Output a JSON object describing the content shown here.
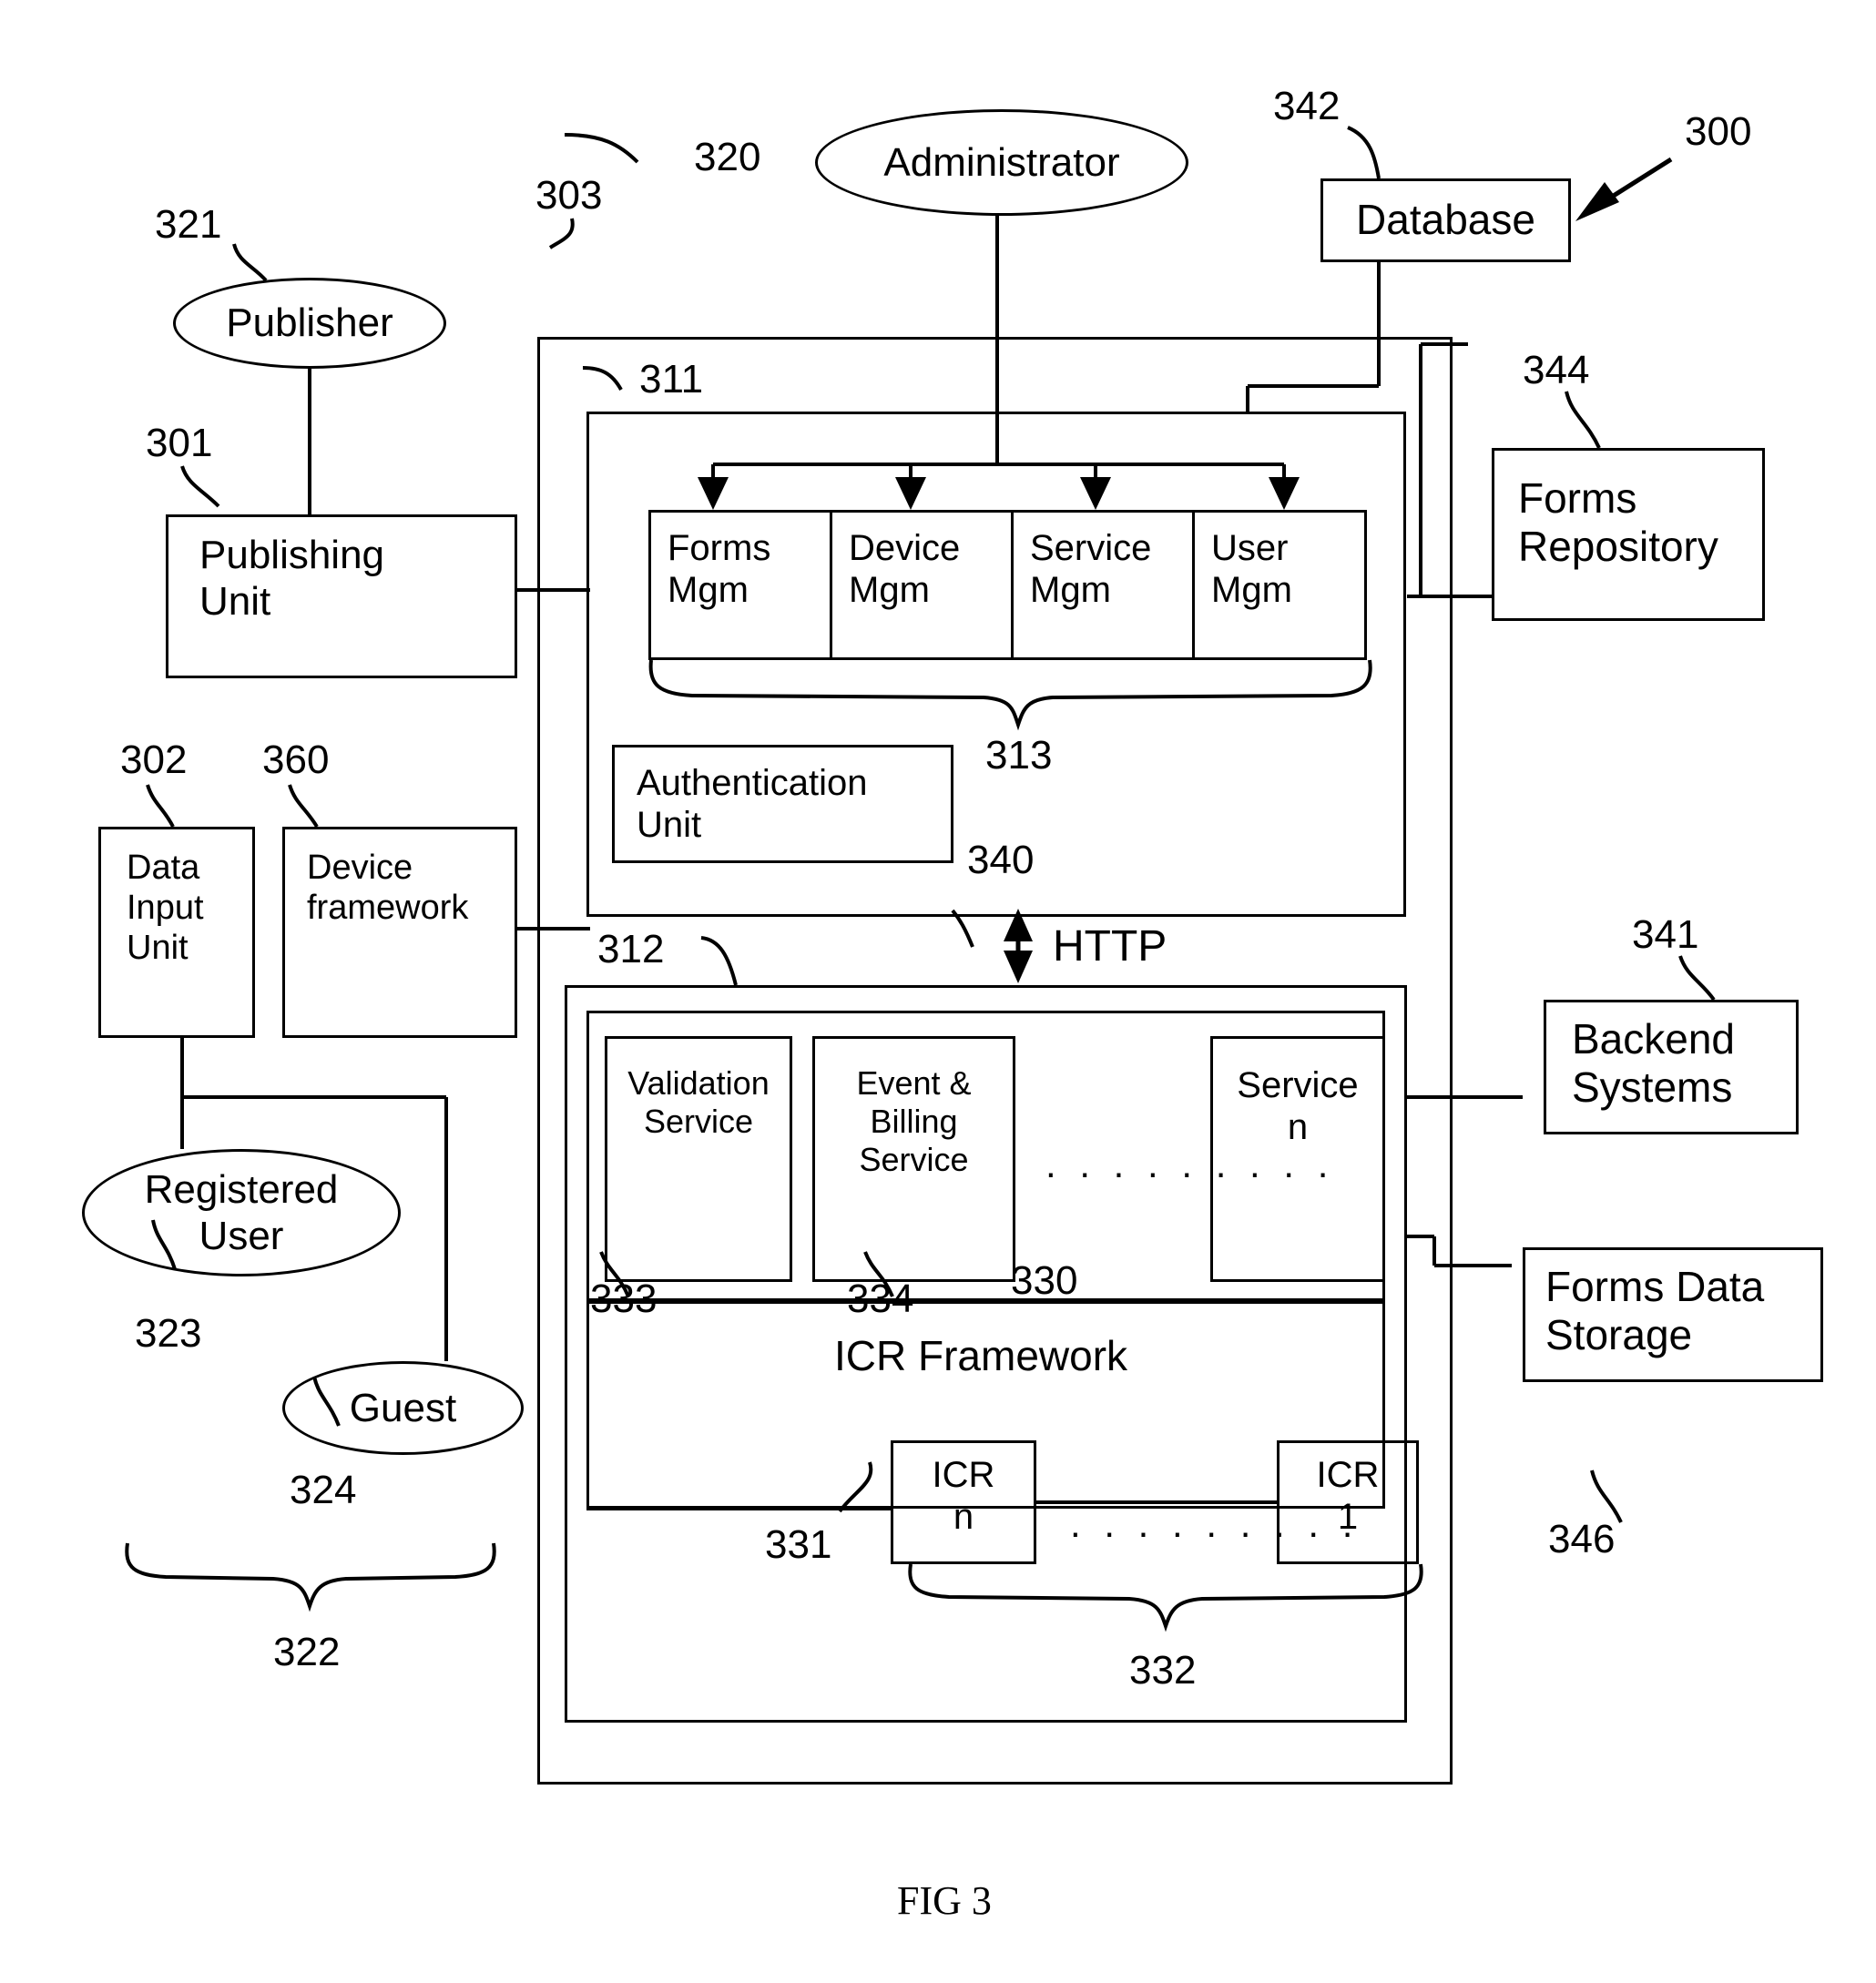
{
  "figure": {
    "caption": "FIG 3",
    "system_ref": "300"
  },
  "actors": [
    {
      "name": "publisher",
      "label": "Publisher",
      "ref": "321"
    },
    {
      "name": "administrator",
      "label": "Administrator",
      "ref": "320"
    },
    {
      "name": "registered-user",
      "label": "Registered\nUser",
      "ref": "323"
    },
    {
      "name": "guest",
      "label": "Guest",
      "ref": "324"
    }
  ],
  "groups": [
    {
      "name": "users-group",
      "ref": "322"
    },
    {
      "name": "management-group",
      "ref": "313"
    },
    {
      "name": "icr-group",
      "ref": "332"
    }
  ],
  "client_side": {
    "publishing_unit": {
      "label": "Publishing\nUnit",
      "ref": "301"
    },
    "data_input_unit": {
      "label": "Data\nInput\nUnit",
      "ref": "302"
    },
    "device_framework": {
      "label": "Device\nframework",
      "ref": "360"
    }
  },
  "server": {
    "outer_ref": "303",
    "management_layer": {
      "ref": "311",
      "modules": [
        {
          "label": "Forms\nMgm"
        },
        {
          "label": "Device\nMgm"
        },
        {
          "label": "Service\nMgm"
        },
        {
          "label": "User\nMgm"
        }
      ],
      "authentication_unit": {
        "label": "Authentication\nUnit",
        "ref": "340"
      }
    },
    "protocol_label": "HTTP",
    "service_layer": {
      "ref": "312",
      "services_ref": "330",
      "services": [
        {
          "label": "Validation\nService",
          "ref": "333"
        },
        {
          "label": "Event &\nBilling\nService",
          "ref": "334"
        },
        {
          "label": "Service\nn",
          "ref": ""
        }
      ],
      "services_ellipsis": ". . . . . . . . .",
      "icr_framework": {
        "label": "ICR Framework",
        "ref": "331"
      },
      "icr_modules": [
        {
          "label": "ICR\nn"
        },
        {
          "label": "ICR\n1"
        }
      ],
      "icr_ellipsis": ". . . . . . . . ."
    }
  },
  "external": [
    {
      "name": "database",
      "label": "Database",
      "ref": "342"
    },
    {
      "name": "forms-repository",
      "label": "Forms\nRepository",
      "ref": "344"
    },
    {
      "name": "backend-systems",
      "label": "Backend\nSystems",
      "ref": "341"
    },
    {
      "name": "forms-data-storage",
      "label": "Forms Data\nStorage",
      "ref": "346"
    }
  ]
}
